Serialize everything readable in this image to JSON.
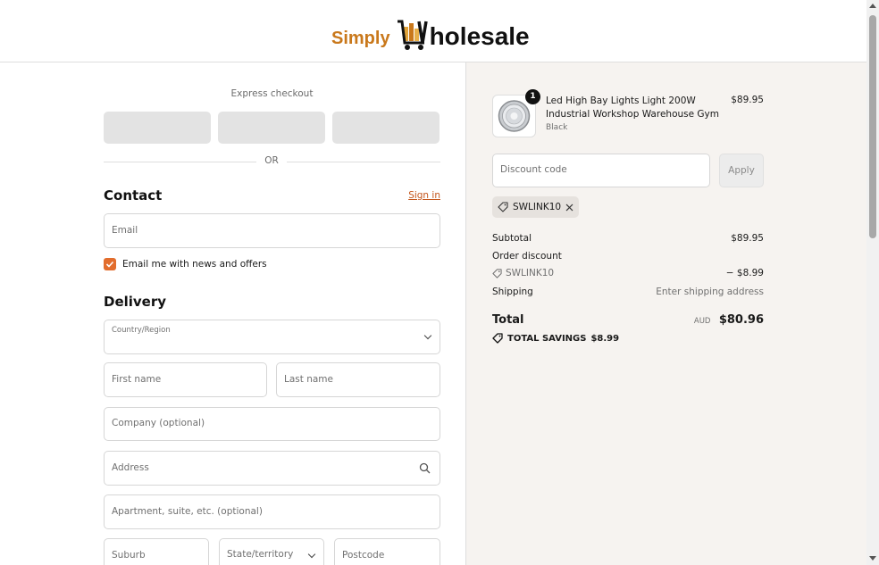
{
  "header": {
    "logo_simply": "Simply",
    "logo_rest": "holesale"
  },
  "express": {
    "title": "Express checkout",
    "or": "OR"
  },
  "contact": {
    "title": "Contact",
    "sign_in": "Sign in",
    "email_placeholder": "Email",
    "newsletter_label": "Email me with news and offers",
    "newsletter_checked": true
  },
  "delivery": {
    "title": "Delivery",
    "country_label": "Country/Region",
    "first_name": "First name",
    "last_name": "Last name",
    "company": "Company (optional)",
    "address": "Address",
    "apartment": "Apartment, suite, etc. (optional)",
    "suburb": "Suburb",
    "state": "State/territory",
    "postcode": "Postcode"
  },
  "order": {
    "product": {
      "name": "Led High Bay Lights Light 200W Industrial Workshop Warehouse Gym",
      "variant": "Black",
      "price": "$89.95",
      "quantity": "1"
    },
    "discount_placeholder": "Discount code",
    "apply_label": "Apply",
    "applied_code": "SWLINK10",
    "subtotal_label": "Subtotal",
    "subtotal_value": "$89.95",
    "order_discount_label": "Order discount",
    "discount_code": "SWLINK10",
    "discount_value": "− $8.99",
    "shipping_label": "Shipping",
    "shipping_value": "Enter shipping address",
    "total_label": "Total",
    "total_currency": "AUD",
    "total_value": "$80.96",
    "savings_label": "TOTAL SAVINGS",
    "savings_value": "$8.99"
  },
  "colors": {
    "accent": "#e26d2d",
    "link": "#c4561b",
    "logo_orange": "#c9781b",
    "summary_bg": "#f6f3f0"
  }
}
